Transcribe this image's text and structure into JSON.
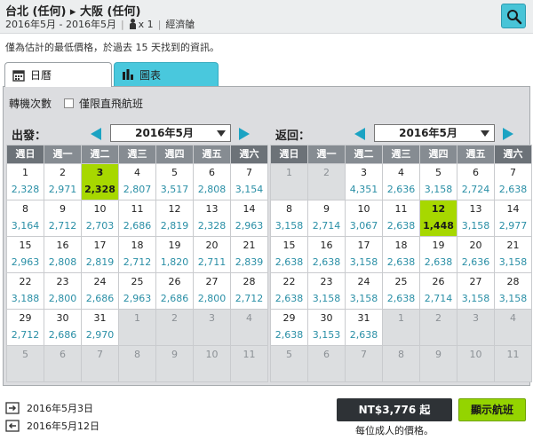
{
  "header": {
    "route": "台北 (任何) ▸ 大阪 (任何)",
    "dates": "2016年5月 - 2016年5月",
    "passengers": "x 1",
    "cabin": "經濟艙"
  },
  "notice": "僅為估計的最低價格，於過去 15 天找到的資訊。",
  "tabs": {
    "calendar": "日曆",
    "chart": "圖表"
  },
  "filters": {
    "stops_label": "轉機次數",
    "direct_only_label": "僅限直飛航班"
  },
  "weekdays": [
    "週日",
    "週一",
    "週二",
    "週三",
    "週四",
    "週五",
    "週六"
  ],
  "calendars": [
    {
      "title": "出發：",
      "month": "2016年5月",
      "cells": [
        {
          "d": "1",
          "p": "2,328"
        },
        {
          "d": "2",
          "p": "2,971"
        },
        {
          "d": "3",
          "p": "2,328",
          "sel": true
        },
        {
          "d": "4",
          "p": "2,807"
        },
        {
          "d": "5",
          "p": "3,517"
        },
        {
          "d": "6",
          "p": "2,808"
        },
        {
          "d": "7",
          "p": "3,154"
        },
        {
          "d": "8",
          "p": "3,164"
        },
        {
          "d": "9",
          "p": "2,712"
        },
        {
          "d": "10",
          "p": "2,703"
        },
        {
          "d": "11",
          "p": "2,686"
        },
        {
          "d": "12",
          "p": "2,819"
        },
        {
          "d": "13",
          "p": "2,328"
        },
        {
          "d": "14",
          "p": "2,963"
        },
        {
          "d": "15",
          "p": "2,963"
        },
        {
          "d": "16",
          "p": "2,808"
        },
        {
          "d": "17",
          "p": "2,819"
        },
        {
          "d": "18",
          "p": "2,712"
        },
        {
          "d": "19",
          "p": "1,820"
        },
        {
          "d": "20",
          "p": "2,711"
        },
        {
          "d": "21",
          "p": "2,839"
        },
        {
          "d": "22",
          "p": "3,188"
        },
        {
          "d": "23",
          "p": "2,800"
        },
        {
          "d": "24",
          "p": "2,686"
        },
        {
          "d": "25",
          "p": "2,963"
        },
        {
          "d": "26",
          "p": "2,686"
        },
        {
          "d": "27",
          "p": "2,800"
        },
        {
          "d": "28",
          "p": "2,712"
        },
        {
          "d": "29",
          "p": "2,712"
        },
        {
          "d": "30",
          "p": "2,686"
        },
        {
          "d": "31",
          "p": "2,970"
        },
        {
          "d": "1",
          "dis": true
        },
        {
          "d": "2",
          "dis": true
        },
        {
          "d": "3",
          "dis": true
        },
        {
          "d": "4",
          "dis": true
        },
        {
          "d": "5",
          "dis": true
        },
        {
          "d": "6",
          "dis": true
        },
        {
          "d": "7",
          "dis": true
        },
        {
          "d": "8",
          "dis": true
        },
        {
          "d": "9",
          "dis": true
        },
        {
          "d": "10",
          "dis": true
        },
        {
          "d": "11",
          "dis": true
        }
      ]
    },
    {
      "title": "返回：",
      "month": "2016年5月",
      "cells": [
        {
          "d": "1",
          "dis": true
        },
        {
          "d": "2",
          "dis": true
        },
        {
          "d": "3",
          "p": "4,351"
        },
        {
          "d": "4",
          "p": "2,636"
        },
        {
          "d": "5",
          "p": "3,158"
        },
        {
          "d": "6",
          "p": "2,724"
        },
        {
          "d": "7",
          "p": "2,638"
        },
        {
          "d": "8",
          "p": "3,158"
        },
        {
          "d": "9",
          "p": "2,714"
        },
        {
          "d": "10",
          "p": "3,067"
        },
        {
          "d": "11",
          "p": "2,638"
        },
        {
          "d": "12",
          "p": "1,448",
          "sel": true
        },
        {
          "d": "13",
          "p": "3,158"
        },
        {
          "d": "14",
          "p": "2,977"
        },
        {
          "d": "15",
          "p": "2,638"
        },
        {
          "d": "16",
          "p": "2,638"
        },
        {
          "d": "17",
          "p": "3,158"
        },
        {
          "d": "18",
          "p": "2,638"
        },
        {
          "d": "19",
          "p": "2,638"
        },
        {
          "d": "20",
          "p": "2,636"
        },
        {
          "d": "21",
          "p": "3,158"
        },
        {
          "d": "22",
          "p": "2,638"
        },
        {
          "d": "23",
          "p": "3,158"
        },
        {
          "d": "24",
          "p": "3,158"
        },
        {
          "d": "25",
          "p": "2,638"
        },
        {
          "d": "26",
          "p": "2,714"
        },
        {
          "d": "27",
          "p": "3,158"
        },
        {
          "d": "28",
          "p": "3,158"
        },
        {
          "d": "29",
          "p": "2,638"
        },
        {
          "d": "30",
          "p": "3,153"
        },
        {
          "d": "31",
          "p": "2,638"
        },
        {
          "d": "1",
          "dis": true
        },
        {
          "d": "2",
          "dis": true
        },
        {
          "d": "3",
          "dis": true
        },
        {
          "d": "4",
          "dis": true
        },
        {
          "d": "5",
          "dis": true
        },
        {
          "d": "6",
          "dis": true
        },
        {
          "d": "7",
          "dis": true
        },
        {
          "d": "8",
          "dis": true
        },
        {
          "d": "9",
          "dis": true
        },
        {
          "d": "10",
          "dis": true
        },
        {
          "d": "11",
          "dis": true
        }
      ]
    }
  ],
  "footer": {
    "depart_date": "2016年5月3日",
    "return_date": "2016年5月12日",
    "price": "NT$3,776 起",
    "price_note": "每位成人的價格。",
    "show_flights": "顯示航班"
  },
  "colors": {
    "accent": "#49c8dd",
    "selected": "#a7d800",
    "price_text": "#2a8fa6",
    "button": "#94d400"
  }
}
